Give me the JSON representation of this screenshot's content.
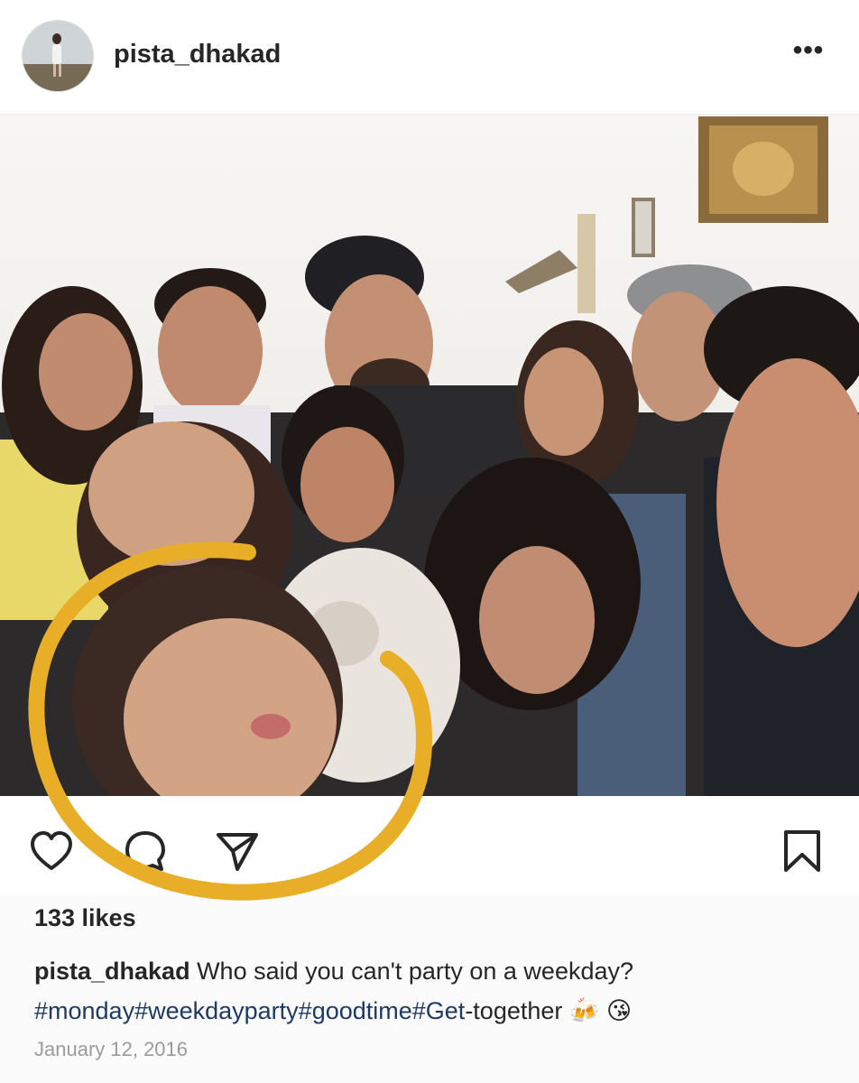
{
  "post": {
    "username": "pista_dhakad",
    "more_label": "•••",
    "likes": "133 likes",
    "caption_user": "pista_dhakad",
    "caption_text": "Who said you can't party on a weekday?",
    "caption_tags": "#monday#weekdayparty#goodtime#Get",
    "caption_tail": "-together",
    "caption_emoji": "🍻 😘",
    "date": "January 12, 2016"
  },
  "colors": {
    "text": "#262626",
    "hashtag": "#1d3a66",
    "date": "#9b9b9b",
    "annotation": "#e8ae28"
  },
  "icons": [
    "avatar",
    "more-icon",
    "heart-icon",
    "comment-icon",
    "share-icon",
    "bookmark-icon"
  ]
}
